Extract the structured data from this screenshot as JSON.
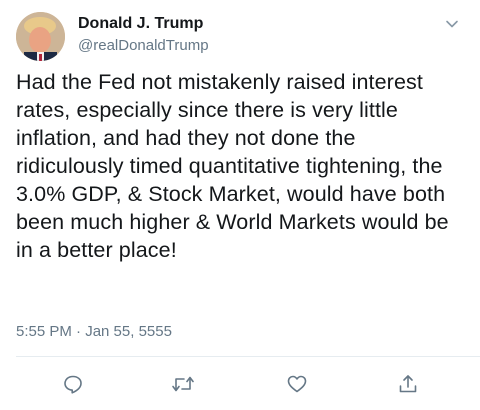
{
  "author": {
    "display_name": "Donald J. Trump",
    "handle": "@realDonaldTrump"
  },
  "tweet": {
    "text": "Had the Fed not mistakenly raised interest rates, especially since there is very little inflation, and had they not done the ridiculously timed quantitative tightening, the 3.0% GDP, & Stock Market, would have both been much higher & World Markets would be in a better place!",
    "timestamp": "5:55 PM · Jan 55, 5555"
  },
  "icons": {
    "menu": "chevron-down-icon",
    "reply": "reply-icon",
    "retweet": "retweet-icon",
    "like": "heart-icon",
    "share": "share-icon"
  },
  "colors": {
    "text": "#14171a",
    "secondary": "#657786",
    "icon": "#657786",
    "divider": "#e6ecf0"
  }
}
